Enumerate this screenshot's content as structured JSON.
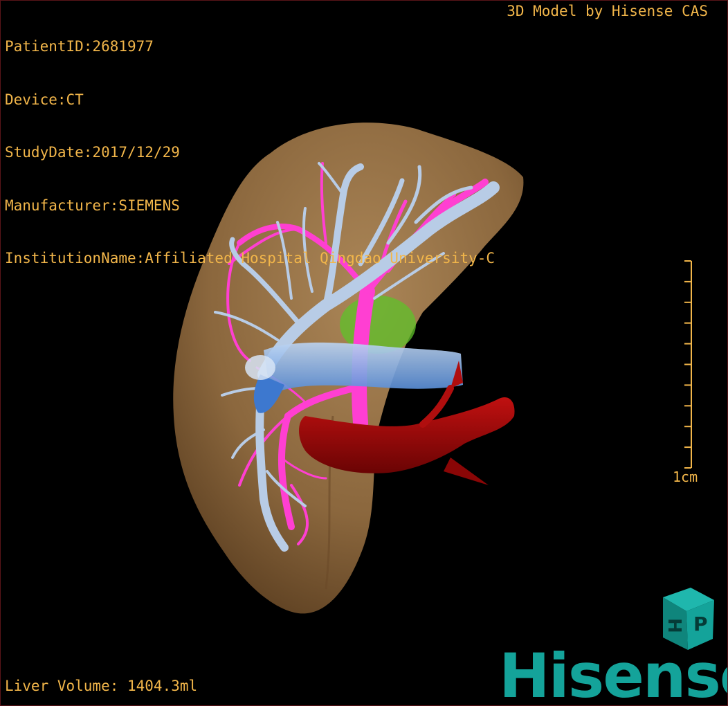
{
  "overlay": {
    "patient_id": "PatientID:2681977",
    "device": "Device:CT",
    "study_date": "StudyDate:2017/12/29",
    "manufacturer": "Manufacturer:SIEMENS",
    "institution": "InstitutionName:Affiliated Hospital Qingdao University-C",
    "model_credit": "3D Model by Hisense CAS",
    "liver_volume": "Liver Volume: 1404.3ml"
  },
  "scale_bar": {
    "label": "1cm",
    "ticks": 10
  },
  "logo": {
    "brand": "Hisense",
    "cube_letters": [
      "H",
      "P"
    ]
  },
  "structures": [
    {
      "name": "liver",
      "color": "#8f6a3f"
    },
    {
      "name": "hepatic-vein",
      "color": "#b8cce6"
    },
    {
      "name": "portal-vein",
      "color": "#ff3fd2"
    },
    {
      "name": "inferior-vena-cava",
      "color": "#6ea5ef"
    },
    {
      "name": "aorta",
      "color": "#9a0808"
    },
    {
      "name": "gallbladder",
      "color": "#5fc12a"
    }
  ],
  "colors": {
    "overlay_text": "#f2b64a",
    "brand": "#14a39a",
    "background": "#000000"
  }
}
